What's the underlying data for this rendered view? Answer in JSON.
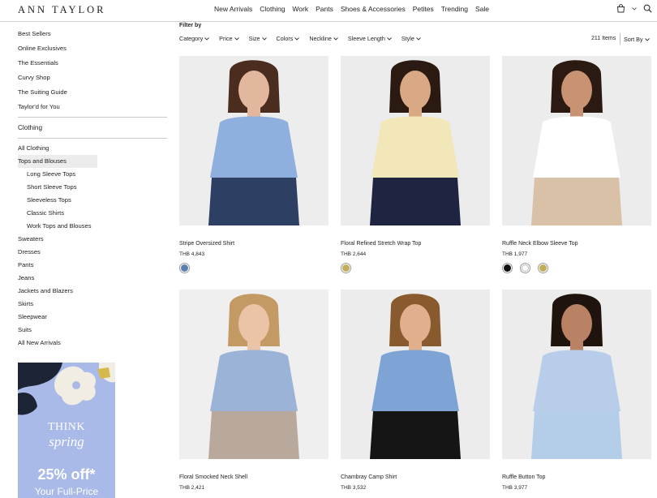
{
  "header": {
    "logo": "ANN TAYLOR",
    "nav": [
      "New Arrivals",
      "Clothing",
      "Work",
      "Pants",
      "Shoes & Accessories",
      "Petites",
      "Trending",
      "Sale"
    ]
  },
  "sidebar": {
    "top_links": [
      "Best Sellers",
      "Online Exclusives",
      "The Essentials",
      "Curvy Shop",
      "The Suiting Guide",
      "Taylor'd for You"
    ],
    "heading": "Clothing",
    "categories": [
      {
        "label": "All Clothing",
        "level": 0,
        "active": false
      },
      {
        "label": "Tops and Blouses",
        "level": 0,
        "active": true
      },
      {
        "label": "Long Sleeve Tops",
        "level": 1,
        "active": false
      },
      {
        "label": "Short Sleeve Tops",
        "level": 1,
        "active": false
      },
      {
        "label": "Sleeveless Tops",
        "level": 1,
        "active": false
      },
      {
        "label": "Classic Shirts",
        "level": 1,
        "active": false
      },
      {
        "label": "Work Tops and Blouses",
        "level": 1,
        "active": false
      },
      {
        "label": "Sweaters",
        "level": 0,
        "active": false
      },
      {
        "label": "Dresses",
        "level": 0,
        "active": false
      },
      {
        "label": "Pants",
        "level": 0,
        "active": false
      },
      {
        "label": "Jeans",
        "level": 0,
        "active": false
      },
      {
        "label": "Jackets and Blazers",
        "level": 0,
        "active": false
      },
      {
        "label": "Skirts",
        "level": 0,
        "active": false
      },
      {
        "label": "Sleepwear",
        "level": 0,
        "active": false
      },
      {
        "label": "Suits",
        "level": 0,
        "active": false
      },
      {
        "label": "All New Arrivals",
        "level": 0,
        "active": false
      }
    ]
  },
  "promo": {
    "line1": "THINK",
    "line2": "spring",
    "line3": "25% off*",
    "line4": "Your Full-Price"
  },
  "filters": {
    "label": "Filter by",
    "items": [
      "Category",
      "Price",
      "Size",
      "Colors",
      "Neckline",
      "Sleeve Length",
      "Style"
    ],
    "count": "211 Items",
    "sort_label": "Sort By"
  },
  "products": [
    {
      "name": "Stripe Oversized Shirt",
      "price": "THB 4,843",
      "swatches": [
        "#5b7fb3"
      ],
      "bg": "#ededed",
      "top_color": "#8fb0de",
      "bottom_color": "#2d3f63",
      "skin": "#e3b79d",
      "hair": "#4a2d1f"
    },
    {
      "name": "Floral Refined Stretch Wrap Top",
      "price": "THB 2,644",
      "swatches": [
        "#c2ad5a"
      ],
      "bg": "#ececec",
      "top_color": "#f1e7b8",
      "bottom_color": "#1f2540",
      "skin": "#d9a985",
      "hair": "#2a1a12"
    },
    {
      "name": "Ruffle Neck Elbow Sleeve Top",
      "price": "THB 1,977",
      "swatches": [
        "#111111",
        "#ffffff",
        "#c2ad5a"
      ],
      "bg": "#ececec",
      "top_color": "#ffffff",
      "bottom_color": "#d8c1a6",
      "skin": "#c99273",
      "hair": "#2b1a12"
    },
    {
      "name": "Floral Smocked Neck Shell",
      "price": "THB 2,421",
      "swatches": [],
      "bg": "#efefef",
      "top_color": "#9bb3d6",
      "bottom_color": "#b9a99c",
      "skin": "#ebc3a6",
      "hair": "#c49a64"
    },
    {
      "name": "Chambray Camp Shirt",
      "price": "THB 3,532",
      "swatches": [],
      "bg": "#ececec",
      "top_color": "#7ea4d6",
      "bottom_color": "#151515",
      "skin": "#e0b08e",
      "hair": "#8a5a2f"
    },
    {
      "name": "Ruffle Button Top",
      "price": "THB 3,977",
      "swatches": [],
      "bg": "#ececec",
      "top_color": "#b7cdea",
      "bottom_color": "#b4cde8",
      "skin": "#b98264",
      "hair": "#1f130d"
    }
  ]
}
